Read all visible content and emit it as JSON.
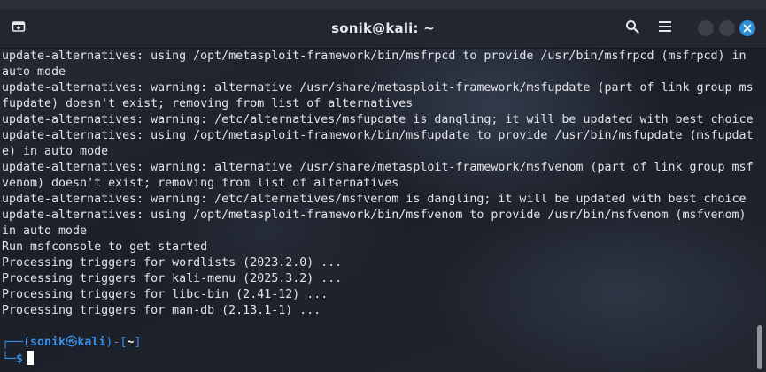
{
  "window": {
    "title": "sonik@kali: ~"
  },
  "icons": {
    "new_tab": "new-tab-icon",
    "search": "search-icon",
    "menu": "hamburger-menu-icon",
    "minimize": "minimize-icon",
    "maximize": "maximize-icon",
    "close": "close-icon"
  },
  "colors": {
    "accent": "#2f8dd8",
    "prompt": "#3b8ee6",
    "text": "#e2e4e8"
  },
  "terminal": {
    "lines": [
      "update-alternatives: using /opt/metasploit-framework/bin/msfrpcd to provide /usr/bin/msfrpcd (msfrpcd) in",
      "auto mode",
      "update-alternatives: warning: alternative /usr/share/metasploit-framework/msfupdate (part of link group ms",
      "fupdate) doesn't exist; removing from list of alternatives",
      "update-alternatives: warning: /etc/alternatives/msfupdate is dangling; it will be updated with best choice",
      "update-alternatives: using /opt/metasploit-framework/bin/msfupdate to provide /usr/bin/msfupdate (msfupdat",
      "e) in auto mode",
      "update-alternatives: warning: alternative /usr/share/metasploit-framework/msfvenom (part of link group msf",
      "venom) doesn't exist; removing from list of alternatives",
      "update-alternatives: warning: /etc/alternatives/msfvenom is dangling; it will be updated with best choice",
      "update-alternatives: using /opt/metasploit-framework/bin/msfvenom to provide /usr/bin/msfvenom (msfvenom)",
      "in auto mode",
      "Run msfconsole to get started",
      "Processing triggers for wordlists (2023.2.0) ...",
      "Processing triggers for kali-menu (2025.3.2) ...",
      "Processing triggers for libc-bin (2.41-12) ...",
      "Processing triggers for man-db (2.13.1-1) ..."
    ],
    "prompt": {
      "frame_top": "┌──(",
      "user": "sonik",
      "at": "㉿",
      "host": "kali",
      "mid": ")-[",
      "dir": "~",
      "end": "]",
      "frame_bottom": "└─",
      "symbol": "$"
    }
  }
}
